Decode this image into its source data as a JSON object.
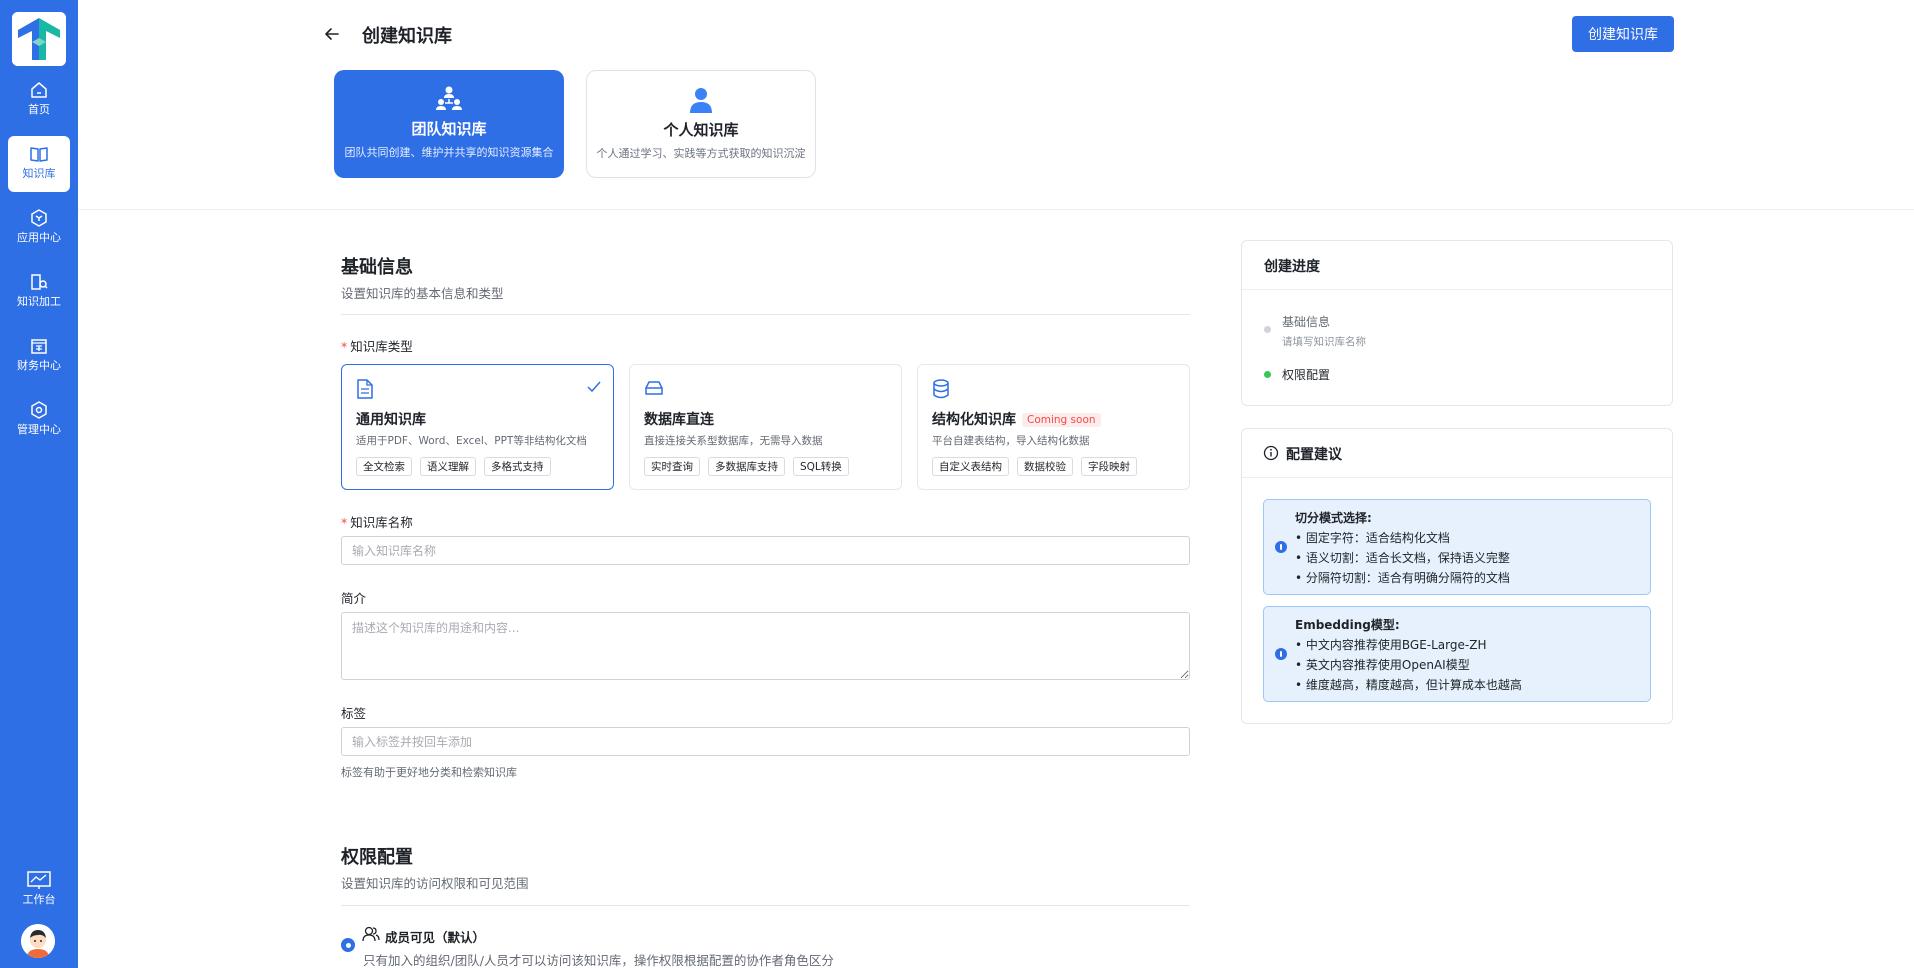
{
  "sidebar": {
    "items": [
      {
        "label": "首页"
      },
      {
        "label": "知识库"
      },
      {
        "label": "应用中心"
      },
      {
        "label": "知识加工"
      },
      {
        "label": "财务中心"
      },
      {
        "label": "管理中心"
      }
    ],
    "workbench_label": "工作台"
  },
  "header": {
    "title": "创建知识库",
    "create_button": "创建知识库"
  },
  "scope": [
    {
      "title": "团队知识库",
      "desc": "团队共同创建、维护并共享的知识资源集合",
      "selected": true
    },
    {
      "title": "个人知识库",
      "desc": "个人通过学习、实践等方式获取的知识沉淀",
      "selected": false
    }
  ],
  "basic": {
    "title": "基础信息",
    "subtitle": "设置知识库的基本信息和类型",
    "type_label": "知识库类型",
    "types": [
      {
        "title": "通用知识库",
        "desc": "适用于PDF、Word、Excel、PPT等非结构化文档",
        "tags": [
          "全文检索",
          "语义理解",
          "多格式支持"
        ],
        "selected": true
      },
      {
        "title": "数据库直连",
        "desc": "直接连接关系型数据库，无需导入数据",
        "tags": [
          "实时查询",
          "多数据库支持",
          "SQL转换"
        ],
        "selected": false
      },
      {
        "title": "结构化知识库",
        "badge": "Coming soon",
        "desc": "平台自建表结构，导入结构化数据",
        "tags": [
          "自定义表结构",
          "数据校验",
          "字段映射"
        ],
        "selected": false
      }
    ],
    "name_label": "知识库名称",
    "name_placeholder": "输入知识库名称",
    "intro_label": "简介",
    "intro_placeholder": "描述这个知识库的用途和内容...",
    "tags_label": "标签",
    "tags_placeholder": "输入标签并按回车添加",
    "tags_hint": "标签有助于更好地分类和检索知识库"
  },
  "permission": {
    "title": "权限配置",
    "subtitle": "设置知识库的访问权限和可见范围",
    "option_title": "成员可见（默认）",
    "option_desc": "只有加入的组织/团队/人员才可以访问该知识库，操作权限根据配置的协作者角色区分"
  },
  "progress": {
    "title": "创建进度",
    "steps": [
      {
        "label": "基础信息",
        "sub": "请填写知识库名称",
        "done": false
      },
      {
        "label": "权限配置",
        "done": true
      }
    ]
  },
  "advice": {
    "title": "配置建议",
    "tips": [
      {
        "title": "切分模式选择:",
        "lines": [
          "• 固定字符：适合结构化文档",
          "• 语义切割：适合长文档，保持语义完整",
          "• 分隔符切割：适合有明确分隔符的文档"
        ]
      },
      {
        "title": "Embedding模型:",
        "lines": [
          "• 中文内容推荐使用BGE-Large-ZH",
          "• 英文内容推荐使用OpenAI模型",
          "• 维度越高，精度越高，但计算成本也越高"
        ]
      }
    ]
  },
  "colors": {
    "primary": "#2f6fe6",
    "success": "#34c759",
    "danger": "#f54a45",
    "tip_bg": "#e6f1fd"
  }
}
